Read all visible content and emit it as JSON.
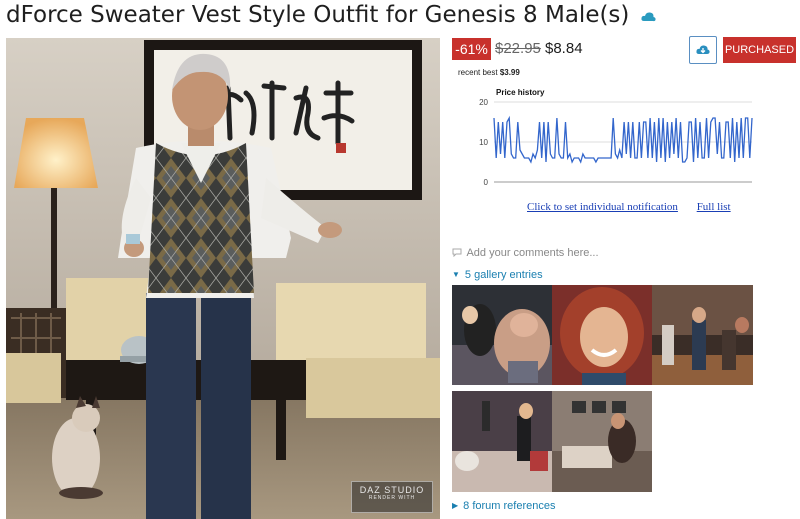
{
  "product": {
    "title": "dForce Sweater Vest Style Outfit for Genesis 8 Male(s)",
    "discount": "-61%",
    "old_price": "$22.95",
    "new_price": "$8.84",
    "purchased_label": "PURCHASED",
    "recent_best_prefix": "recent best",
    "recent_best_value": "$3.99"
  },
  "hero": {
    "watermark_line1": "DAZ STUDIO",
    "watermark_line2": "RENDER WITH"
  },
  "chart_data": {
    "type": "line",
    "title": "Price history",
    "ylim": [
      0,
      20
    ],
    "yticks": [
      "20",
      "10",
      "0"
    ],
    "grid": true,
    "color": "#3366cc",
    "values": [
      16,
      6,
      15,
      7,
      15,
      6,
      15,
      16,
      7,
      6,
      6,
      15,
      8,
      7,
      6,
      6,
      6,
      5,
      7,
      6,
      8,
      15,
      6,
      15,
      5,
      15,
      7,
      6,
      6,
      16,
      7,
      6,
      6,
      15,
      6,
      7,
      5,
      6,
      6,
      6,
      5,
      7,
      6,
      6,
      6,
      6,
      6,
      5,
      6,
      6,
      6,
      6,
      6,
      6,
      6,
      16,
      7,
      6,
      8,
      6,
      15,
      7,
      15,
      6,
      15,
      6,
      6,
      15,
      6,
      15,
      15,
      6,
      16,
      6,
      15,
      5,
      16,
      6,
      16,
      5,
      15,
      6,
      15,
      7,
      16,
      6,
      15,
      5,
      5,
      6,
      15,
      15,
      5,
      16,
      6,
      15,
      6,
      6,
      16,
      6,
      15,
      16,
      16,
      7,
      15,
      6,
      6,
      15,
      15,
      6,
      16,
      5,
      15,
      6,
      16,
      6,
      16,
      16,
      6,
      16
    ]
  },
  "links": {
    "notification": "Click to set individual notification",
    "full_list": "Full list"
  },
  "comments": {
    "placeholder": "Add your comments here..."
  },
  "gallery": {
    "label": "5 gallery entries"
  },
  "forum": {
    "label": "8 forum references"
  },
  "colors": {
    "accent_red": "#c8312c",
    "link_teal": "#1a7fb0",
    "chart_blue": "#3366cc"
  }
}
